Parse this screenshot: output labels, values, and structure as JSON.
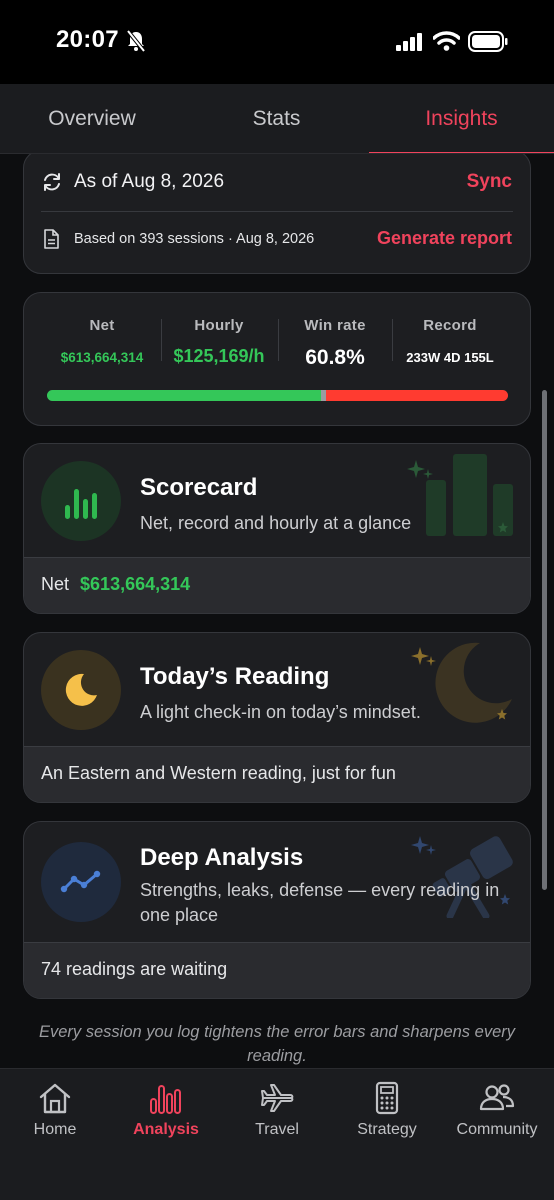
{
  "status_bar": {
    "time": "20:07"
  },
  "tabs": [
    {
      "label": "Overview",
      "active": false
    },
    {
      "label": "Stats",
      "active": false
    },
    {
      "label": "Insights",
      "active": true
    }
  ],
  "sync_card": {
    "as_of": "As of Aug 8, 2026",
    "sync_label": "Sync",
    "based_on": "Based on 393 sessions · Aug 8, 2026",
    "generate_label": "Generate report"
  },
  "stats": {
    "net": {
      "label": "Net",
      "value": "$613,664,314"
    },
    "hourly": {
      "label": "Hourly",
      "value": "$125,169/h"
    },
    "win_rate": {
      "label": "Win rate",
      "value": "60.8%"
    },
    "record": {
      "label": "Record",
      "value": "233W 4D 155L"
    },
    "record_bar": {
      "wins": 233,
      "draws": 4,
      "losses": 155
    }
  },
  "scorecard": {
    "title": "Scorecard",
    "subtitle": "Net, record and hourly at a glance",
    "footer_label": "Net",
    "footer_value": "$613,664,314"
  },
  "todays_reading": {
    "title": "Today’s Reading",
    "subtitle": "A light check-in on today’s mindset.",
    "footer": "An Eastern and Western reading, just for fun"
  },
  "deep_analysis": {
    "title": "Deep Analysis",
    "subtitle": "Strengths, leaks, defense — every reading in one place",
    "footer": "74 readings are waiting"
  },
  "footnote": "Every session you log tightens the error bars and sharpens every reading.",
  "bottom_nav": [
    {
      "label": "Home",
      "icon": "home-icon",
      "active": false
    },
    {
      "label": "Analysis",
      "icon": "bar-chart-icon",
      "active": true
    },
    {
      "label": "Travel",
      "icon": "airplane-icon",
      "active": false
    },
    {
      "label": "Strategy",
      "icon": "calculator-icon",
      "active": false
    },
    {
      "label": "Community",
      "icon": "people-icon",
      "active": false
    }
  ],
  "colors": {
    "accent": "#f0435c",
    "positive": "#34c759",
    "negative": "#ff3b30",
    "draw": "#9a9ca1",
    "scorecard_icon": "#2fb84f",
    "moon": "#f5c04a",
    "analysis_icon": "#4a7fd6"
  }
}
